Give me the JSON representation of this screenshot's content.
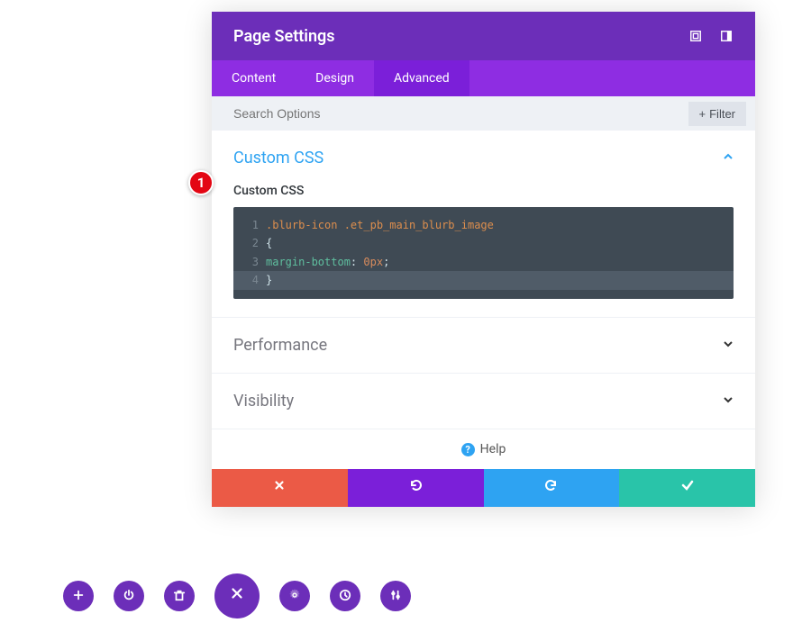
{
  "marker": "1",
  "header": {
    "title": "Page Settings"
  },
  "tabs": [
    {
      "label": "Content",
      "active": false
    },
    {
      "label": "Design",
      "active": false
    },
    {
      "label": "Advanced",
      "active": true
    }
  ],
  "search": {
    "placeholder": "Search Options",
    "filter_label": "Filter"
  },
  "sections": {
    "custom_css": {
      "title": "Custom CSS",
      "field_label": "Custom CSS",
      "code": {
        "selector": ".blurb-icon .et_pb_main_blurb_image",
        "open_brace": "{",
        "property": "margin-bottom",
        "value": "0px",
        "semicolon": ";",
        "close_brace": "}",
        "line_numbers": [
          "1",
          "2",
          "3",
          "4"
        ]
      }
    },
    "performance": {
      "title": "Performance"
    },
    "visibility": {
      "title": "Visibility"
    }
  },
  "help": {
    "label": "Help"
  }
}
